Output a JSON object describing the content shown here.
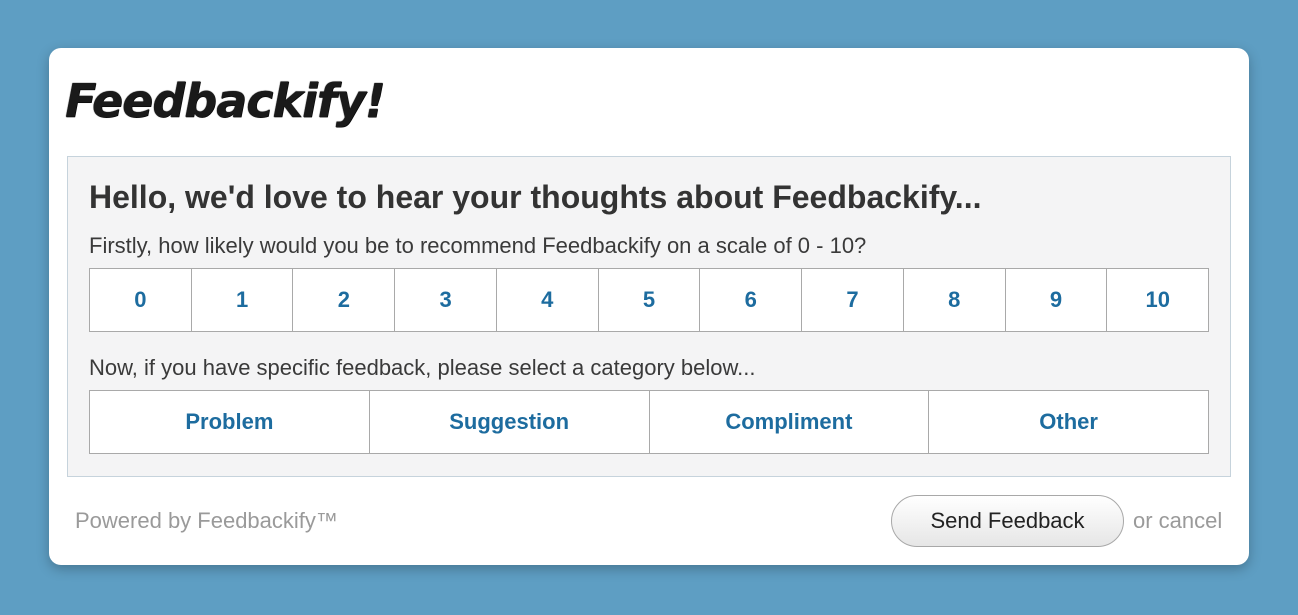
{
  "logo": {
    "text": "Feedbackify!"
  },
  "panel": {
    "headline": "Hello, we'd love to hear your thoughts about Feedbackify...",
    "scale_question": "Firstly, how likely would you be to recommend Feedbackify on a scale of 0 - 10?",
    "scale_options": [
      "0",
      "1",
      "2",
      "3",
      "4",
      "5",
      "6",
      "7",
      "8",
      "9",
      "10"
    ],
    "category_question": "Now, if you have specific feedback, please select a category below...",
    "category_options": [
      "Problem",
      "Suggestion",
      "Compliment",
      "Other"
    ]
  },
  "footer": {
    "powered_by": "Powered by Feedbackify™",
    "send_label": "Send Feedback",
    "cancel_label": "or cancel"
  },
  "colors": {
    "background": "#5e9ec3",
    "button_text": "#1d6c9f",
    "panel_bg": "#f4f4f5"
  }
}
